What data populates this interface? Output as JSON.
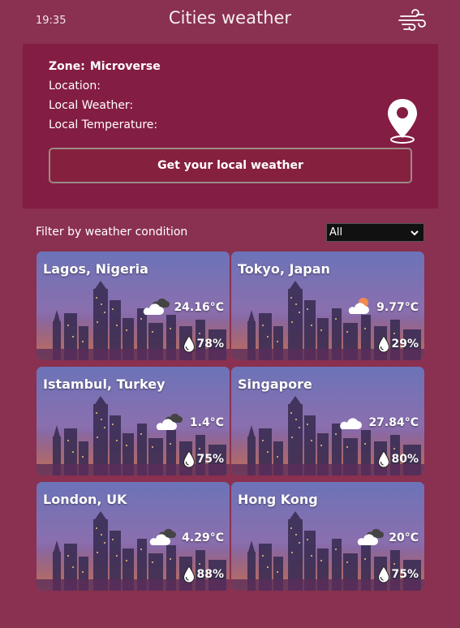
{
  "header": {
    "time": "19:35",
    "title": "Cities weather",
    "wind_icon": "wind-icon"
  },
  "zone": {
    "zone_label": "Zone:",
    "zone_value": "Microverse",
    "location_label": "Location:",
    "weather_label": "Local Weather:",
    "temperature_label": "Local Temperature:",
    "pin_icon": "map-pin-icon",
    "button_label": "Get your local weather"
  },
  "filter": {
    "label": "Filter by weather condition",
    "selected": "All"
  },
  "colors": {
    "background": "#8a3050",
    "panel": "#841d43",
    "button_border": "#9c8a86"
  },
  "cities": [
    {
      "name": "Lagos, Nigeria",
      "temp": "24.16°C",
      "humidity": "78%",
      "icon": "cloudy-icon"
    },
    {
      "name": "Tokyo, Japan",
      "temp": "9.77°C",
      "humidity": "29%",
      "icon": "partly-cloudy-icon"
    },
    {
      "name": "Istambul, Turkey",
      "temp": "1.4°C",
      "humidity": "75%",
      "icon": "cloudy-icon"
    },
    {
      "name": "Singapore",
      "temp": "27.84°C",
      "humidity": "80%",
      "icon": "cloud-icon"
    },
    {
      "name": "London, UK",
      "temp": "4.29°C",
      "humidity": "88%",
      "icon": "cloudy-icon"
    },
    {
      "name": "Hong Kong",
      "temp": "20°C",
      "humidity": "75%",
      "icon": "cloudy-icon"
    }
  ]
}
